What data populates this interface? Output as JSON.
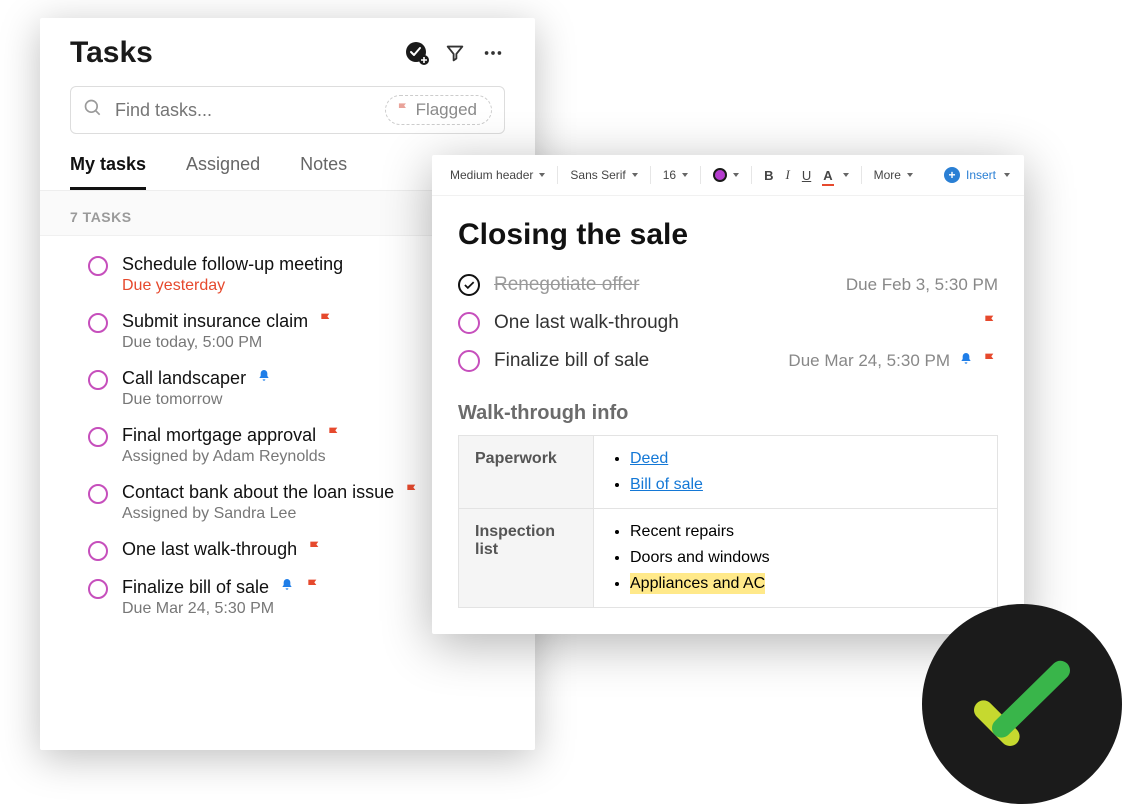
{
  "tasks_panel": {
    "title": "Tasks",
    "search_placeholder": "Find tasks...",
    "flagged_chip": "Flagged",
    "tabs": {
      "my_tasks": "My tasks",
      "assigned": "Assigned",
      "notes": "Notes"
    },
    "count_label": "7 TASKS",
    "items": [
      {
        "title": "Schedule follow-up meeting",
        "meta": "Due yesterday",
        "meta_red": true
      },
      {
        "title": "Submit insurance claim",
        "meta": "Due today, 5:00 PM",
        "flag": true
      },
      {
        "title": "Call landscaper",
        "meta": "Due tomorrow",
        "bell": true
      },
      {
        "title": "Final mortgage approval",
        "meta": "Assigned by Adam Reynolds",
        "flag": true
      },
      {
        "title": "Contact bank about the loan issue",
        "meta": "Assigned by Sandra Lee",
        "flag": true
      },
      {
        "title": "One last walk-through",
        "flag": true
      },
      {
        "title": "Finalize bill of sale",
        "meta": "Due Mar 24, 5:30 PM",
        "bell": true,
        "flag": true
      }
    ]
  },
  "editor_toolbar": {
    "heading": "Medium header",
    "font": "Sans Serif",
    "size": "16",
    "bold": "B",
    "italic": "I",
    "underline": "U",
    "textcolor": "A",
    "more": "More",
    "insert": "Insert"
  },
  "note": {
    "title": "Closing the sale",
    "tasks": [
      {
        "title": "Renegotiate offer",
        "done": true,
        "due": "Due Feb 3, 5:30 PM"
      },
      {
        "title": "One last walk-through",
        "flag": true
      },
      {
        "title": "Finalize bill of sale",
        "due": "Due Mar 24, 5:30 PM",
        "bell": true,
        "flag": true
      }
    ],
    "subhead": "Walk-through info",
    "table": {
      "paperwork_label": "Paperwork",
      "paperwork_items": {
        "deed": "Deed",
        "bos": "Bill of sale"
      },
      "inspection_label": "Inspection list",
      "inspection_items": {
        "repairs": "Recent repairs",
        "doors": "Doors and windows",
        "appliances": "Appliances and AC"
      }
    }
  }
}
